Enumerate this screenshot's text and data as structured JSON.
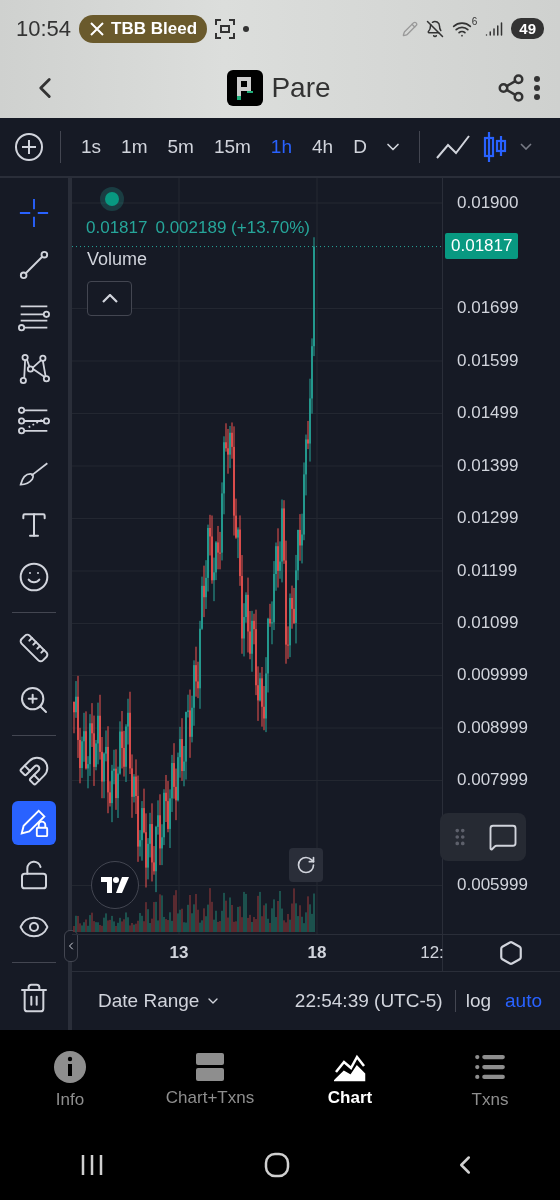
{
  "status_bar": {
    "time": "10:54",
    "notification": "TBB Bleed",
    "wifi_badge": "6",
    "battery": "49"
  },
  "header": {
    "title": "Pare"
  },
  "toolbar": {
    "intervals": [
      {
        "label": "1s",
        "selected": false
      },
      {
        "label": "1m",
        "selected": false
      },
      {
        "label": "5m",
        "selected": false
      },
      {
        "label": "15m",
        "selected": false
      },
      {
        "label": "1h",
        "selected": true
      },
      {
        "label": "4h",
        "selected": false
      },
      {
        "label": "D",
        "selected": false
      }
    ],
    "chart_types": [
      {
        "kind": "line",
        "selected": false
      },
      {
        "kind": "candles",
        "selected": true
      }
    ]
  },
  "tools": [
    {
      "kind": "crosshair",
      "active": true
    },
    {
      "kind": "trend-line",
      "active": false
    },
    {
      "kind": "fib",
      "active": false
    },
    {
      "kind": "pattern",
      "active": false
    },
    {
      "kind": "forecast",
      "active": false
    },
    {
      "kind": "brush",
      "active": false
    },
    {
      "kind": "text",
      "active": false
    },
    {
      "kind": "emoji",
      "active": false
    },
    {
      "kind": "divider"
    },
    {
      "kind": "ruler",
      "active": false
    },
    {
      "kind": "zoom",
      "active": false
    },
    {
      "kind": "divider"
    },
    {
      "kind": "magnet",
      "active": false
    },
    {
      "kind": "lock-drawing",
      "active": true
    },
    {
      "kind": "unlock",
      "active": false
    },
    {
      "kind": "eye",
      "active": false
    },
    {
      "kind": "divider"
    },
    {
      "kind": "trash",
      "active": false
    }
  ],
  "legend": {
    "price": "0.01817",
    "change": "0.002189 (+13.70%)",
    "volume_label": "Volume"
  },
  "price_axis": {
    "ticks": [
      "0.01900",
      "0.01699",
      "0.01599",
      "0.01499",
      "0.01399",
      "0.01299",
      "0.01199",
      "0.01099",
      "0.009999",
      "0.008999",
      "0.007999",
      "0.005999"
    ],
    "current_price": "0.01817"
  },
  "time_axis": [
    "13",
    "18",
    "12:"
  ],
  "bottom_bar": {
    "date_range": "Date Range",
    "clock": "22:54:39 (UTC-5)",
    "log": {
      "label": "log",
      "on": false
    },
    "auto": {
      "label": "auto",
      "on": true
    }
  },
  "bottom_nav": [
    {
      "label": "Info",
      "kind": "info",
      "selected": false
    },
    {
      "label": "Chart+Txns",
      "kind": "split",
      "selected": false
    },
    {
      "label": "Chart",
      "kind": "chart",
      "selected": true
    },
    {
      "label": "Txns",
      "kind": "list",
      "selected": false
    }
  ]
}
